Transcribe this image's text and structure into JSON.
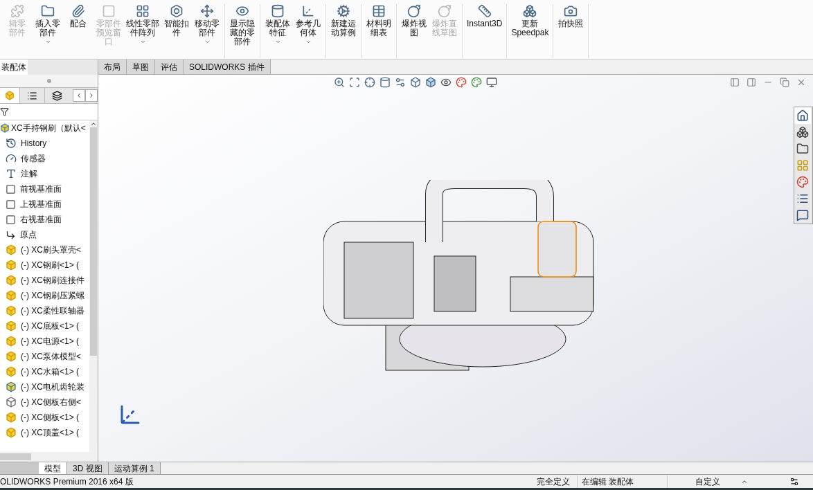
{
  "ribbon": {
    "groups": [
      {
        "items": [
          {
            "label": "辑零部件",
            "disabled": true,
            "dropdown": false
          },
          {
            "label": "插入零部件",
            "disabled": false,
            "dropdown": true
          },
          {
            "label": "配合",
            "disabled": false,
            "dropdown": false
          },
          {
            "label": "零部件预览窗口",
            "disabled": true,
            "dropdown": false
          },
          {
            "label": "线性零部件阵列",
            "disabled": false,
            "dropdown": true
          },
          {
            "label": "智能扣件",
            "disabled": false,
            "dropdown": false
          },
          {
            "label": "移动零部件",
            "disabled": false,
            "dropdown": true
          }
        ]
      },
      {
        "items": [
          {
            "label": "显示隐藏的零部件",
            "disabled": false,
            "dropdown": false
          }
        ]
      },
      {
        "items": [
          {
            "label": "装配体特征",
            "disabled": false,
            "dropdown": true
          },
          {
            "label": "参考几何体",
            "disabled": false,
            "dropdown": true
          }
        ]
      },
      {
        "items": [
          {
            "label": "新建运动算例",
            "disabled": false,
            "dropdown": false
          }
        ]
      },
      {
        "items": [
          {
            "label": "材料明细表",
            "disabled": false,
            "dropdown": false
          }
        ]
      },
      {
        "items": [
          {
            "label": "爆炸视图",
            "disabled": false,
            "dropdown": false
          },
          {
            "label": "爆炸直线草图",
            "disabled": true,
            "dropdown": false
          }
        ]
      },
      {
        "items": [
          {
            "label": "Instant3D",
            "disabled": false,
            "dropdown": false
          }
        ]
      },
      {
        "items": [
          {
            "label": "更新 Speedpak",
            "disabled": false,
            "dropdown": false
          }
        ]
      },
      {
        "items": [
          {
            "label": "拍快照",
            "disabled": false,
            "dropdown": false
          }
        ]
      }
    ]
  },
  "tabs": [
    {
      "label": "装配体",
      "selected": true
    },
    {
      "label": "布局",
      "selected": false
    },
    {
      "label": "草图",
      "selected": false
    },
    {
      "label": "评估",
      "selected": false
    },
    {
      "label": "SOLIDWORKS 插件",
      "selected": false
    }
  ],
  "tree": {
    "root": "XC手持钢刷（默认<",
    "items": [
      {
        "kind": "history",
        "label": "History"
      },
      {
        "kind": "sensor",
        "label": "传感器"
      },
      {
        "kind": "annotation",
        "label": "注解"
      },
      {
        "kind": "plane",
        "label": "前视基准面"
      },
      {
        "kind": "plane",
        "label": "上视基准面"
      },
      {
        "kind": "plane",
        "label": "右视基准面"
      },
      {
        "kind": "origin",
        "label": "原点"
      },
      {
        "kind": "part",
        "label": "(-) XC刷头罩壳<"
      },
      {
        "kind": "part",
        "label": "(-) XC钢刷<1> ("
      },
      {
        "kind": "part",
        "label": "(-) XC钢刷连接件"
      },
      {
        "kind": "part",
        "label": "(-) XC钢刷压紧螺"
      },
      {
        "kind": "part",
        "label": "(-) XC柔性联轴器"
      },
      {
        "kind": "part",
        "label": "(-) XC底板<1> ("
      },
      {
        "kind": "part",
        "label": "(-) XC电源<1> ("
      },
      {
        "kind": "part",
        "label": "(-) XC泵体模型<"
      },
      {
        "kind": "part",
        "label": "(-) XC水箱<1> ("
      },
      {
        "kind": "assembly",
        "label": "(-) XC电机齿轮装"
      },
      {
        "kind": "hidden",
        "label": "(-) XC侧板右侧<"
      },
      {
        "kind": "part",
        "label": "(-) XC侧板<1> ("
      },
      {
        "kind": "part",
        "label": "(-) XC顶盖<1> ("
      }
    ]
  },
  "bottom_tabs": [
    {
      "label": "模型",
      "selected": true
    },
    {
      "label": "3D 视图",
      "selected": false
    },
    {
      "label": "运动算例 1",
      "selected": false
    }
  ],
  "status_bar": {
    "product": "OLIDWORKS Premium 2016 x64 版",
    "state": "完全定义",
    "mode": "在编辑 装配体",
    "units": "自定义"
  }
}
